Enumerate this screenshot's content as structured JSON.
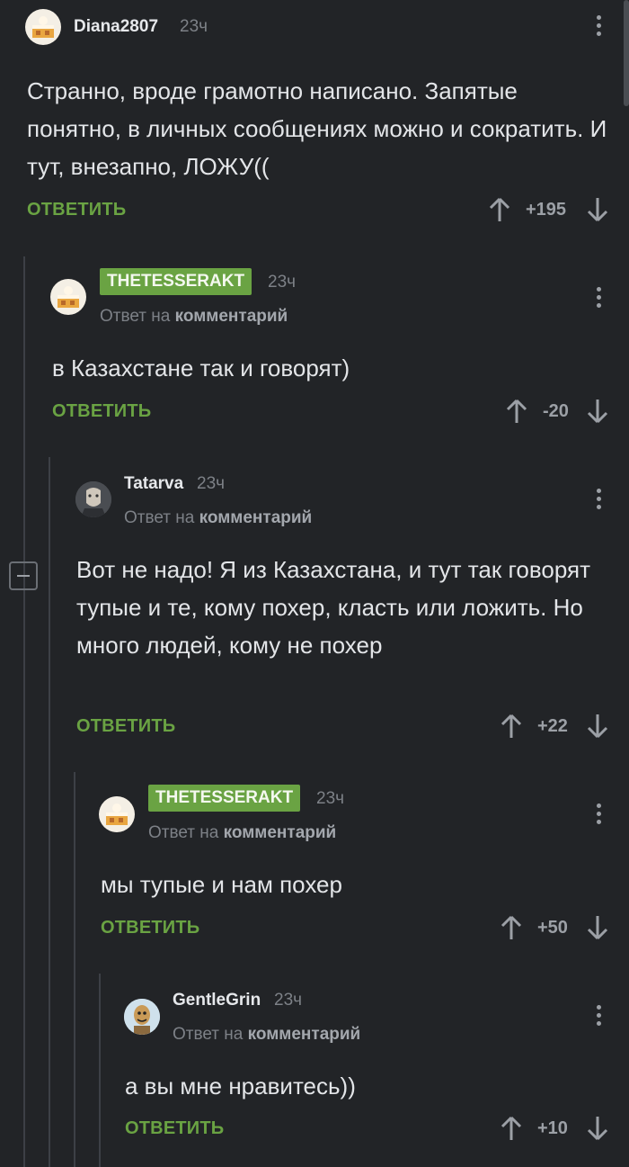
{
  "common": {
    "reply_label": "ОТВЕТИТЬ",
    "reply_to_prefix": "Ответ на",
    "reply_to_target": "комментарий"
  },
  "comments": [
    {
      "username": "Diana2807",
      "time": "23ч",
      "text": "Странно, вроде грамотно написано. Запятые понятно, в личных сообщениях можно и сократить. И тут, внезапно, ЛОЖУ((",
      "rating": "+195",
      "avatar": "cake-avatar-icon"
    },
    {
      "username": "THETESSERAKT",
      "time": "23ч",
      "text": "в Казахстане так и говорят)",
      "rating": "-20",
      "avatar": "cake-avatar-icon",
      "badge_color": "#6aa343"
    },
    {
      "username": "Tatarva",
      "time": "23ч",
      "text": "Вот не надо! Я из Казахстана, и тут так говорят тупые и те, кому похер, класть или ложить. Но много людей, кому не похер",
      "rating": "+22",
      "avatar": "witcher-avatar-icon"
    },
    {
      "username": "THETESSERAKT",
      "time": "23ч",
      "text": "мы тупые и нам похер",
      "rating": "+50",
      "avatar": "cake-avatar-icon",
      "badge_color": "#6aa343"
    },
    {
      "username": "GentleGrin",
      "time": "23ч",
      "text": "а вы мне нравитесь))",
      "rating": "+10",
      "avatar": "cartoon-avatar-icon"
    }
  ],
  "colors": {
    "background": "#222427",
    "accent": "#6aa343",
    "muted": "#7d8187"
  }
}
